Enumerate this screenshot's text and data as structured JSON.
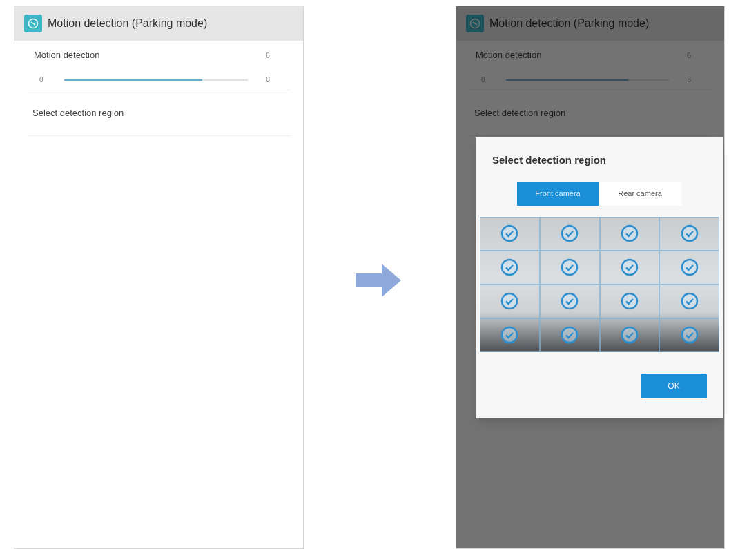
{
  "screens": [
    {
      "header": {
        "title": "Motion detection (Parking mode)"
      },
      "setting": {
        "label": "Motion detection",
        "value": "6",
        "slider": {
          "min": "0",
          "max": "8",
          "level": 0.75
        }
      },
      "region_item": {
        "label": "Select detection region"
      }
    },
    {
      "header": {
        "title": "Motion detection (Parking mode)"
      },
      "setting": {
        "label": "Motion detection",
        "value": "6",
        "slider": {
          "min": "0",
          "max": "8",
          "level": 0.75
        }
      },
      "region_item": {
        "label": "Select detection region"
      },
      "dialog": {
        "title": "Select detection region",
        "tabs": [
          {
            "label": "Front camera",
            "selected": true
          },
          {
            "label": "Rear camera",
            "selected": false
          }
        ],
        "grid": [
          {
            "checked": true
          },
          {
            "checked": true
          },
          {
            "checked": true
          },
          {
            "checked": true
          },
          {
            "checked": true
          },
          {
            "checked": true
          },
          {
            "checked": true
          },
          {
            "checked": true
          },
          {
            "checked": true
          },
          {
            "checked": true
          },
          {
            "checked": true
          },
          {
            "checked": true
          },
          {
            "checked": true
          },
          {
            "checked": true
          },
          {
            "checked": true
          },
          {
            "checked": true
          }
        ],
        "ok_button": "OK"
      }
    }
  ]
}
